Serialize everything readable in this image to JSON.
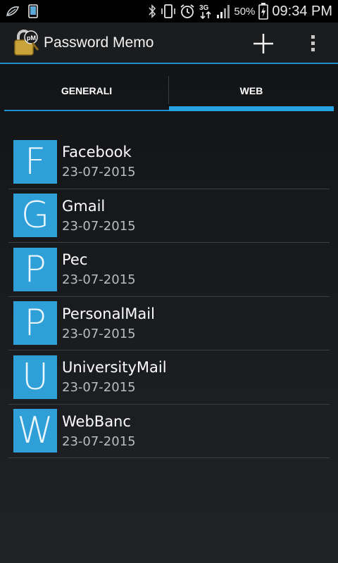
{
  "status_bar": {
    "icons": [
      "leaf-icon",
      "tablet-icon",
      "bluetooth-icon",
      "vibrate-icon",
      "alarm-icon",
      "network-3g-icon",
      "signal-icon",
      "battery-charging-icon"
    ],
    "network_label": "3G",
    "battery": "50%",
    "time": "09:34 PM"
  },
  "action_bar": {
    "title": "Password Memo",
    "app_icon_text": "pM",
    "icons": [
      "add-icon",
      "overflow-menu-icon"
    ]
  },
  "tabs": [
    {
      "label": "GENERALI",
      "selected": false
    },
    {
      "label": "WEB",
      "selected": true
    }
  ],
  "accent_color": "#2f9fd8",
  "items": [
    {
      "letter": "F",
      "name": "Facebook",
      "date": "23-07-2015"
    },
    {
      "letter": "G",
      "name": "Gmail",
      "date": "23-07-2015"
    },
    {
      "letter": "P",
      "name": "Pec",
      "date": "23-07-2015"
    },
    {
      "letter": "P",
      "name": "PersonalMail",
      "date": "23-07-2015"
    },
    {
      "letter": "U",
      "name": "UniversityMail",
      "date": "23-07-2015"
    },
    {
      "letter": "W",
      "name": "WebBanc",
      "date": "23-07-2015"
    }
  ]
}
